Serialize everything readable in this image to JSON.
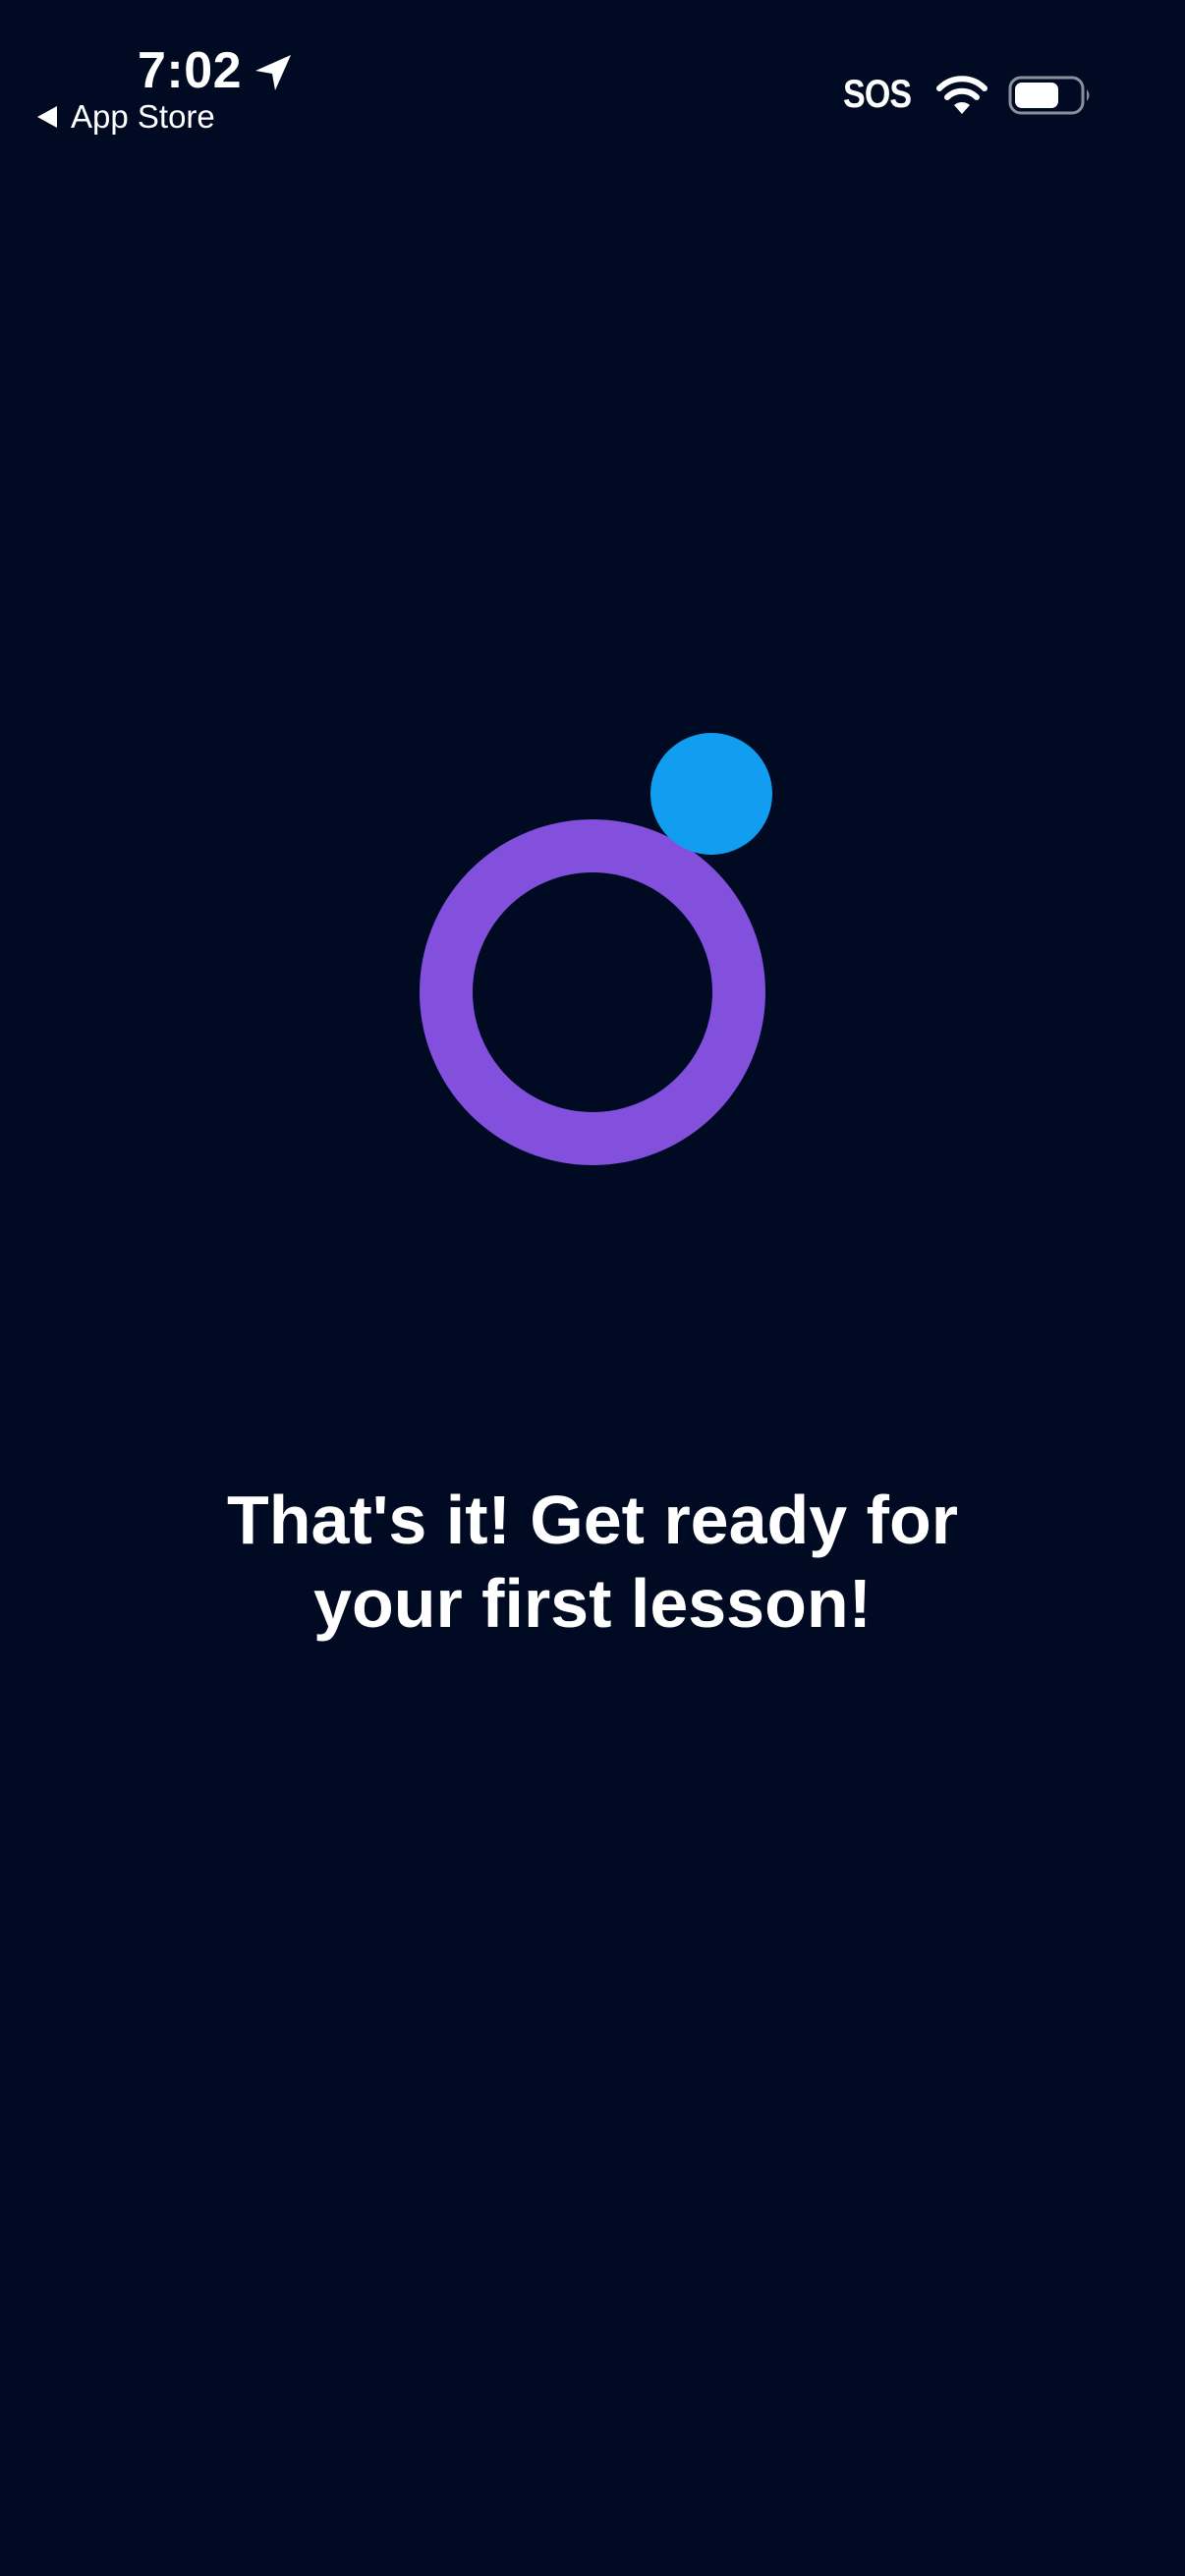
{
  "status_bar": {
    "time": "7:02",
    "back_label": "App Store",
    "signal_label": "SOS",
    "icons": [
      "location-arrow-icon",
      "back-arrow-icon",
      "wifi-icon",
      "battery-icon"
    ]
  },
  "logo": {
    "icon": "app-logo-icon",
    "ring_color": "#8250dc",
    "dot_color": "#129ef0"
  },
  "message": {
    "line1": "That's it! Get ready for",
    "line2": "your first lesson!"
  },
  "colors": {
    "background": "#000a22",
    "text": "#ffffff"
  }
}
